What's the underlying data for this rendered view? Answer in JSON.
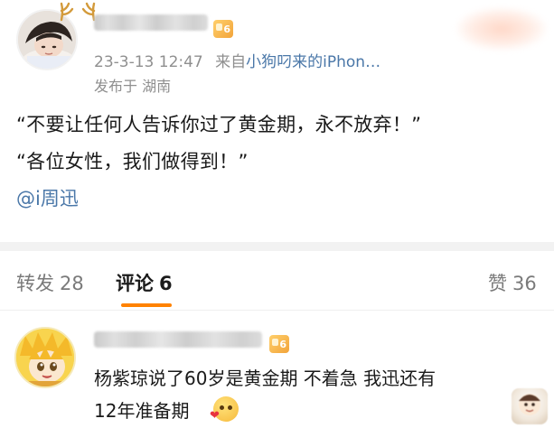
{
  "post": {
    "timestamp": "23-3-13 12:47",
    "source_prefix": "来自",
    "source_name": "小狗叼来的iPhon…",
    "location": "发布于  湖南",
    "badge_level": "6",
    "lines": [
      "“不要让任何人告诉你过了黄金期，永不放弃！”",
      "“各位女性，我们做得到！”"
    ],
    "mention": "@i周迅"
  },
  "tabs": [
    {
      "label": "转发",
      "count": "28"
    },
    {
      "label": "评论",
      "count": "6"
    },
    {
      "label": "赞",
      "count": "36"
    }
  ],
  "active_tab": "评论",
  "comment": {
    "badge_level": "6",
    "lines": [
      "杨紫琼说了60岁是黄金期 不着急 我迅还有",
      "12年准备期"
    ]
  },
  "colors": {
    "accent": "#ff8200",
    "link": "#4a77a8",
    "meta": "#8f8f8f",
    "divider": "#f2f2f2"
  },
  "icons": [
    "avatar-photo",
    "antler-ears",
    "level-badge-icon",
    "blush-heart-emoji",
    "sticker-icon"
  ]
}
